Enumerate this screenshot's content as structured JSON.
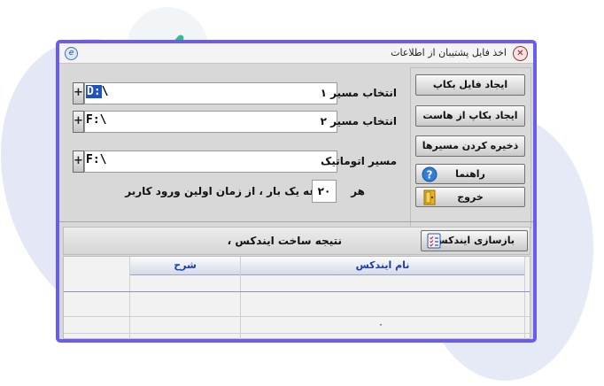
{
  "window": {
    "title": "اخذ فایل پشتیبان از اطلاعات",
    "close_glyph": "✕"
  },
  "paths": {
    "path1": {
      "label": "انتخاب مسیر ۱",
      "value_selected": "D:",
      "value_rest": "\\"
    },
    "path2": {
      "label": "انتخاب مسیر ۲",
      "value": "F:\\"
    },
    "auto": {
      "label": "مسیر اتوماتیک",
      "value": "F:\\"
    },
    "plus_glyph": "+"
  },
  "interval": {
    "prefix": "هر",
    "value": "۲۰",
    "suffix": "دقیقه یک بار ، از زمان اولین ورود کاربر"
  },
  "buttons": {
    "create_backup": "ایجاد فایل بکاپ",
    "backup_from_host": "ایجاد بکاپ از هاست",
    "save_paths": "ذخیره کردن مسیرها",
    "help": "راهنما",
    "exit": "خروج"
  },
  "result": {
    "label": "نتیجه ساخت ایندکس ،",
    "rebuild_button": "بازسازی ایندکس"
  },
  "table": {
    "columns": [
      "نام ایندکس",
      "شرح"
    ],
    "last_row_value": "۰"
  },
  "colors": {
    "accent": "#6a5cf0",
    "check": "#2ec27e",
    "header_text": "#1a3cb8"
  }
}
